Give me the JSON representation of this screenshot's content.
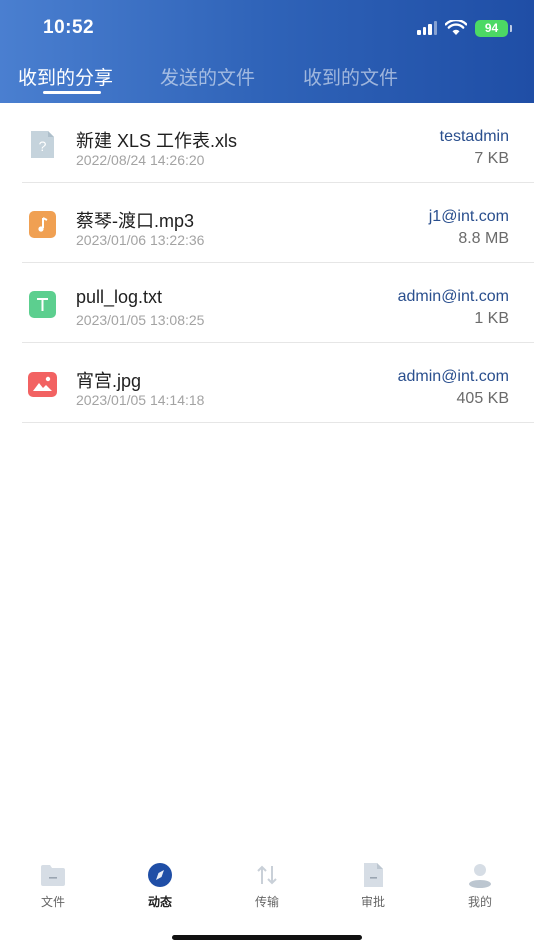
{
  "status_bar": {
    "time": "10:52",
    "battery": "94"
  },
  "tabs": [
    {
      "label": "收到的分享",
      "active": true
    },
    {
      "label": "发送的文件",
      "active": false
    },
    {
      "label": "收到的文件",
      "active": false
    }
  ],
  "files": [
    {
      "name": "新建 XLS 工作表.xls",
      "date": "2022/08/24 14:26:20",
      "sender": "testadmin",
      "size": "7 KB",
      "icon": "unknown-file-icon",
      "icon_color": "#c5d3dc"
    },
    {
      "name": "蔡琴-渡口.mp3",
      "date": "2023/01/06 13:22:36",
      "sender": "j1@int.com",
      "size": "8.8 MB",
      "icon": "audio-file-icon",
      "icon_color": "#f0a052"
    },
    {
      "name": "pull_log.txt",
      "date": "2023/01/05 13:08:25",
      "sender": "admin@int.com",
      "size": "1 KB",
      "icon": "text-file-icon",
      "icon_color": "#5ccf8f"
    },
    {
      "name": "宵宫.jpg",
      "date": "2023/01/05 14:14:18",
      "sender": "admin@int.com",
      "size": "405 KB",
      "icon": "image-file-icon",
      "icon_color": "#f26262"
    }
  ],
  "bottom_nav": [
    {
      "label": "文件",
      "icon": "folder-icon",
      "active": false
    },
    {
      "label": "动态",
      "icon": "compass-icon",
      "active": true
    },
    {
      "label": "传输",
      "icon": "transfer-icon",
      "active": false
    },
    {
      "label": "审批",
      "icon": "document-icon",
      "active": false
    },
    {
      "label": "我的",
      "icon": "user-icon",
      "active": false
    }
  ],
  "colors": {
    "header_start": "#4a7fd0",
    "header_end": "#1f4ea6",
    "sender": "#2a4f8e",
    "nav_active": "#1f4ea6"
  }
}
